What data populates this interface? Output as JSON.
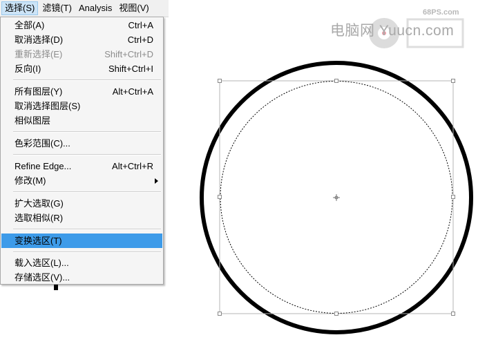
{
  "menubar": {
    "items": [
      {
        "label": "选择(S)"
      },
      {
        "label": "滤镜(T)"
      },
      {
        "label": "Analysis"
      },
      {
        "label": "视图(V)"
      }
    ]
  },
  "dropdown": {
    "items": [
      {
        "label": "全部(A)",
        "shortcut": "Ctrl+A"
      },
      {
        "label": "取消选择(D)",
        "shortcut": "Ctrl+D"
      },
      {
        "label": "重新选择(E)",
        "shortcut": "Shift+Ctrl+D"
      },
      {
        "label": "反向(I)",
        "shortcut": "Shift+Ctrl+I"
      },
      {
        "label": "所有图层(Y)",
        "shortcut": "Alt+Ctrl+A"
      },
      {
        "label": "取消选择图层(S)",
        "shortcut": ""
      },
      {
        "label": "相似图层",
        "shortcut": ""
      },
      {
        "label": "色彩范围(C)...",
        "shortcut": ""
      },
      {
        "label": "Refine Edge...",
        "shortcut": "Alt+Ctrl+R"
      },
      {
        "label": "修改(M)",
        "shortcut": ""
      },
      {
        "label": "扩大选取(G)",
        "shortcut": ""
      },
      {
        "label": "选取相似(R)",
        "shortcut": ""
      },
      {
        "label": "变换选区(T)",
        "shortcut": ""
      },
      {
        "label": "载入选区(L)...",
        "shortcut": ""
      },
      {
        "label": "存储选区(V)...",
        "shortcut": ""
      }
    ]
  },
  "watermark": {
    "text": "电脑网 Yuucn.com",
    "site": "68PS.com"
  },
  "colors": {
    "highlight": "#3d9be9",
    "menubar_active": "#cce4f7",
    "disabled_text": "#8c8c8c",
    "ring": "#000000",
    "bbox": "#b5b5b5"
  },
  "icons": [
    "submenu-arrow-icon",
    "center-crosshair-icon",
    "watermark-logo-icon"
  ]
}
